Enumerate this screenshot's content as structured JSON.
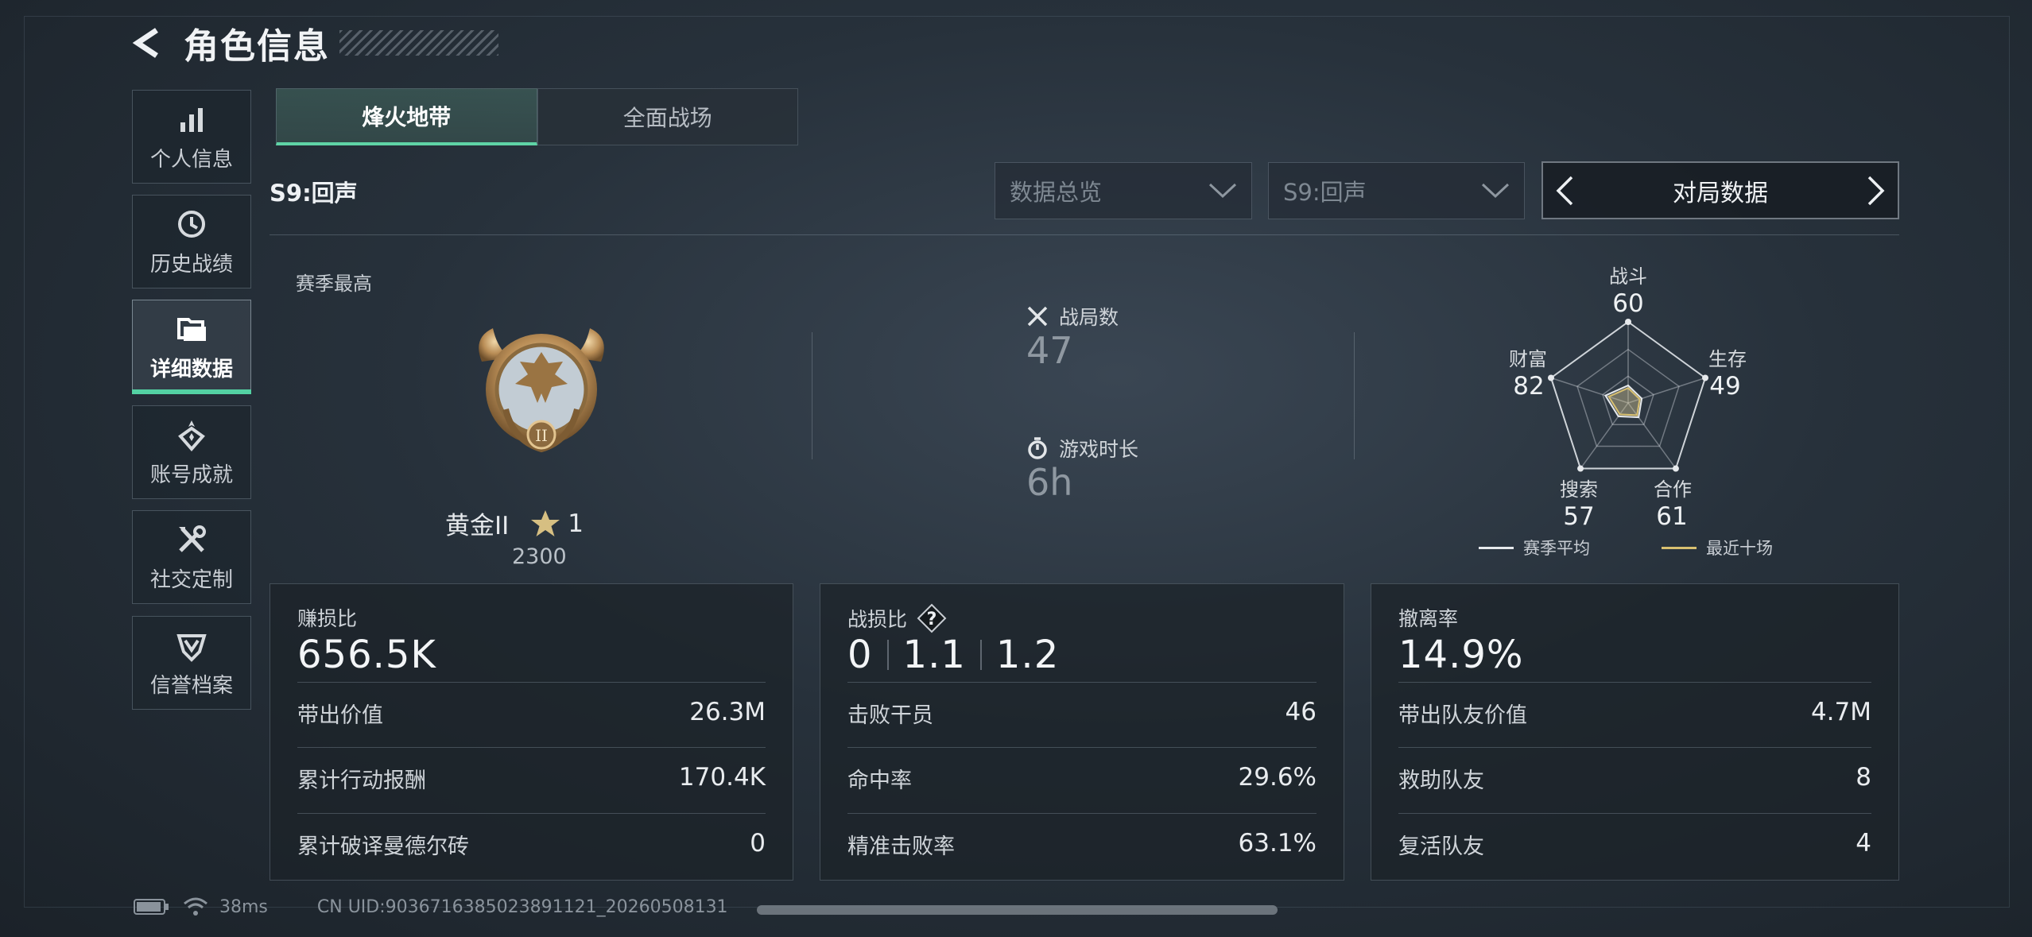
{
  "header": {
    "title": "角色信息"
  },
  "sidebar": {
    "items": [
      {
        "label": "个人信息",
        "icon": "bar-chart-icon"
      },
      {
        "label": "历史战绩",
        "icon": "clock-history-icon"
      },
      {
        "label": "详细数据",
        "icon": "folders-icon",
        "active": true
      },
      {
        "label": "账号成就",
        "icon": "achievement-medal-icon"
      },
      {
        "label": "社交定制",
        "icon": "tools-icon"
      },
      {
        "label": "信誉档案",
        "icon": "shield-badge-icon"
      }
    ]
  },
  "tabs": [
    {
      "label": "烽火地带",
      "active": true
    },
    {
      "label": "全面战场",
      "active": false
    }
  ],
  "season_label": "S9:回声",
  "filters": {
    "overview": "数据总览",
    "season": "S9:回声",
    "pager_label": "对局数据"
  },
  "rank": {
    "section_label": "赛季最高",
    "name": "黄金II",
    "stars": "1",
    "score": "2300"
  },
  "match_stats": {
    "games_label": "战局数",
    "games_value": "47",
    "time_label": "游戏时长",
    "time_value": "6h"
  },
  "radar": {
    "axes": [
      {
        "label": "战斗",
        "value": "60"
      },
      {
        "label": "生存",
        "value": "49"
      },
      {
        "label": "合作",
        "value": "61"
      },
      {
        "label": "搜索",
        "value": "57"
      },
      {
        "label": "财富",
        "value": "82"
      }
    ],
    "legend_season": "赛季平均",
    "legend_recent": "最近十场",
    "colors": {
      "season": "#e6e9ec",
      "recent": "#d8c070"
    }
  },
  "cards": {
    "profit": {
      "title": "赚损比",
      "main": "656.5K",
      "rows": [
        {
          "label": "带出价值",
          "value": "26.3M"
        },
        {
          "label": "累计行动报酬",
          "value": "170.4K"
        },
        {
          "label": "累计破译曼德尔砖",
          "value": "0"
        }
      ]
    },
    "kd": {
      "title": "战损比",
      "help": "?",
      "main_values": [
        "0",
        "1.1",
        "1.2"
      ],
      "rows": [
        {
          "label": "击败干员",
          "value": "46"
        },
        {
          "label": "命中率",
          "value": "29.6%"
        },
        {
          "label": "精准击败率",
          "value": "63.1%"
        }
      ]
    },
    "extract": {
      "title": "撤离率",
      "main": "14.9%",
      "rows": [
        {
          "label": "带出队友价值",
          "value": "4.7M"
        },
        {
          "label": "救助队友",
          "value": "8"
        },
        {
          "label": "复活队友",
          "value": "4"
        }
      ]
    }
  },
  "status_bar": {
    "ping": "38ms",
    "uid": "CN UID:9036716385023891121_20260508131"
  }
}
